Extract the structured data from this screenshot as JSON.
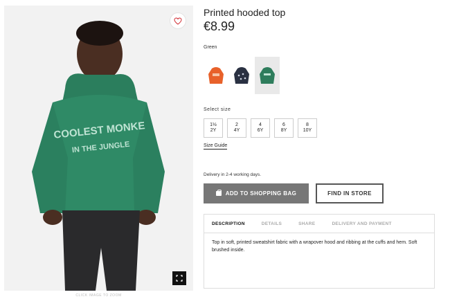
{
  "product": {
    "title": "Printed hooded top",
    "price": "€8.99",
    "color_name": "Green",
    "swatches": [
      {
        "name": "orange",
        "color": "#e8612a"
      },
      {
        "name": "navy",
        "color": "#2a3142"
      },
      {
        "name": "green",
        "color": "#2e7d5c"
      }
    ],
    "select_size_label": "Select size",
    "sizes": [
      {
        "top": "1½",
        "bottom": "2Y"
      },
      {
        "top": "2",
        "bottom": "4Y"
      },
      {
        "top": "4",
        "bottom": "6Y"
      },
      {
        "top": "6",
        "bottom": "8Y"
      },
      {
        "top": "8",
        "bottom": "10Y"
      }
    ],
    "size_guide": "Size Guide",
    "delivery_text": "Delivery in 2-4 working days.",
    "add_to_bag": "ADD TO SHOPPING BAG",
    "find_in_store": "FIND IN STORE",
    "tabs": [
      {
        "label": "DESCRIPTION",
        "active": true
      },
      {
        "label": "DETAILS",
        "active": false
      },
      {
        "label": "SHARE",
        "active": false
      },
      {
        "label": "DELIVERY AND PAYMENT",
        "active": false
      }
    ],
    "description": "Top in soft, printed sweatshirt fabric with a wrapover hood and ribbing at the cuffs and hem. Soft brushed inside."
  },
  "image": {
    "zoom_caption": "CLICK IMAGE TO ZOOM",
    "print_line1": "COOLEST MONKE",
    "print_line2": "IN THE JUNGLE"
  },
  "colors": {
    "hoodie_green": "#2f8a66",
    "button_gray": "#777777"
  }
}
